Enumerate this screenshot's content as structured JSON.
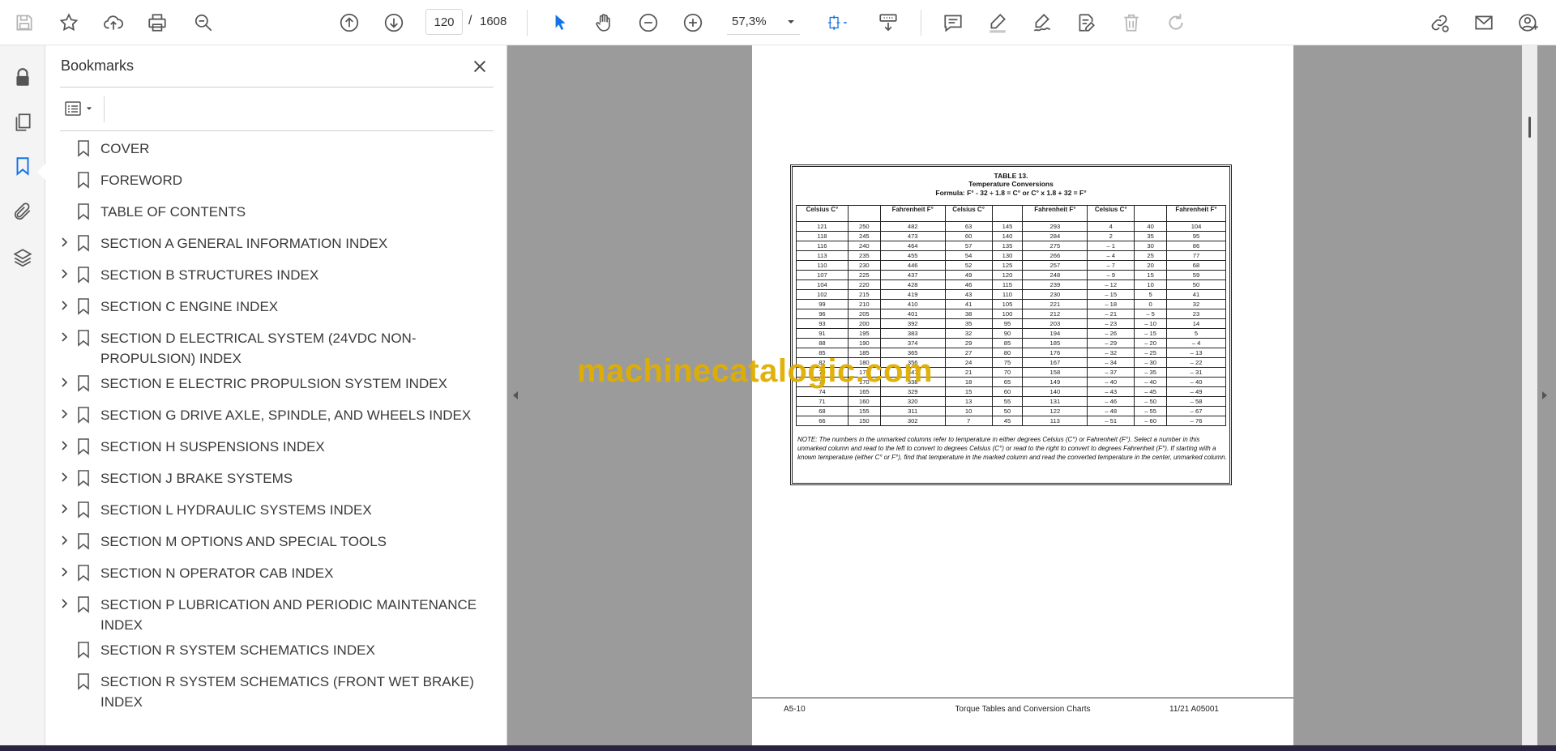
{
  "toolbar": {
    "current_page": "120",
    "page_separator": "/",
    "total_pages": "1608",
    "zoom": "57,3%"
  },
  "bookmarks_panel": {
    "title": "Bookmarks",
    "items": [
      {
        "label": "COVER",
        "expandable": false
      },
      {
        "label": "FOREWORD",
        "expandable": false
      },
      {
        "label": "TABLE OF CONTENTS",
        "expandable": false
      },
      {
        "label": "SECTION A GENERAL INFORMATION INDEX",
        "expandable": true
      },
      {
        "label": "SECTION B STRUCTURES INDEX",
        "expandable": true
      },
      {
        "label": "SECTION C ENGINE INDEX",
        "expandable": true
      },
      {
        "label": "SECTION D ELECTRICAL SYSTEM (24VDC NON-PROPULSION) INDEX",
        "expandable": true
      },
      {
        "label": "SECTION E ELECTRIC PROPULSION SYSTEM INDEX",
        "expandable": true
      },
      {
        "label": "SECTION G DRIVE AXLE, SPINDLE, AND WHEELS INDEX",
        "expandable": true
      },
      {
        "label": "SECTION H SUSPENSIONS INDEX",
        "expandable": true
      },
      {
        "label": "SECTION J BRAKE SYSTEMS",
        "expandable": true
      },
      {
        "label": "SECTION L HYDRAULIC SYSTEMS INDEX",
        "expandable": true
      },
      {
        "label": "SECTION M OPTIONS AND SPECIAL TOOLS",
        "expandable": true
      },
      {
        "label": "SECTION N OPERATOR CAB INDEX",
        "expandable": true
      },
      {
        "label": "SECTION P LUBRICATION AND PERIODIC MAINTENANCE INDEX",
        "expandable": true
      },
      {
        "label": "SECTION R SYSTEM SCHEMATICS INDEX",
        "expandable": false
      },
      {
        "label": "SECTION R SYSTEM SCHEMATICS (FRONT WET BRAKE) INDEX",
        "expandable": false
      }
    ]
  },
  "document": {
    "table_title": "TABLE 13.",
    "table_subtitle": "Temperature Conversions",
    "formula": "Formula:  F° - 32 ÷ 1.8 = C°  or  C° x 1.8 + 32 = F°",
    "headers": [
      "Celsius C°",
      "",
      "Fahrenheit F°",
      "Celsius C°",
      "",
      "Fahrenheit F°",
      "Celsius C°",
      "",
      "Fahrenheit F°"
    ],
    "rows": [
      [
        "121",
        "250",
        "482",
        "63",
        "145",
        "293",
        "4",
        "40",
        "104"
      ],
      [
        "118",
        "245",
        "473",
        "60",
        "140",
        "284",
        "2",
        "35",
        "95"
      ],
      [
        "116",
        "240",
        "464",
        "57",
        "135",
        "275",
        "– 1",
        "30",
        "86"
      ],
      [
        "113",
        "235",
        "455",
        "54",
        "130",
        "266",
        "– 4",
        "25",
        "77"
      ],
      [
        "110",
        "230",
        "446",
        "52",
        "125",
        "257",
        "– 7",
        "20",
        "68"
      ],
      [
        "107",
        "225",
        "437",
        "49",
        "120",
        "248",
        "– 9",
        "15",
        "59"
      ],
      [
        "104",
        "220",
        "428",
        "46",
        "115",
        "239",
        "– 12",
        "10",
        "50"
      ],
      [
        "102",
        "215",
        "419",
        "43",
        "110",
        "230",
        "– 15",
        "5",
        "41"
      ],
      [
        "99",
        "210",
        "410",
        "41",
        "105",
        "221",
        "– 18",
        "0",
        "32"
      ],
      [
        "96",
        "205",
        "401",
        "38",
        "100",
        "212",
        "– 21",
        "– 5",
        "23"
      ],
      [
        "93",
        "200",
        "392",
        "35",
        "95",
        "203",
        "– 23",
        "– 10",
        "14"
      ],
      [
        "91",
        "195",
        "383",
        "32",
        "90",
        "194",
        "– 26",
        "– 15",
        "5"
      ],
      [
        "88",
        "190",
        "374",
        "29",
        "85",
        "185",
        "– 29",
        "– 20",
        "– 4"
      ],
      [
        "85",
        "185",
        "365",
        "27",
        "80",
        "176",
        "– 32",
        "– 25",
        "– 13"
      ],
      [
        "82",
        "180",
        "356",
        "24",
        "75",
        "167",
        "– 34",
        "– 30",
        "– 22"
      ],
      [
        "79",
        "175",
        "347",
        "21",
        "70",
        "158",
        "– 37",
        "– 35",
        "– 31"
      ],
      [
        "77",
        "170",
        "338",
        "18",
        "65",
        "149",
        "– 40",
        "– 40",
        "– 40"
      ],
      [
        "74",
        "165",
        "329",
        "15",
        "60",
        "140",
        "– 43",
        "– 45",
        "– 49"
      ],
      [
        "71",
        "160",
        "320",
        "13",
        "55",
        "131",
        "– 46",
        "– 50",
        "– 58"
      ],
      [
        "68",
        "155",
        "311",
        "10",
        "50",
        "122",
        "– 48",
        "– 55",
        "– 67"
      ],
      [
        "66",
        "150",
        "302",
        "7",
        "45",
        "113",
        "– 51",
        "– 60",
        "– 76"
      ]
    ],
    "note": "NOTE: The numbers in the unmarked columns refer to temperature in either degrees Celsius (C°) or Fahrenheit (F°). Select a number in this unmarked column and read to the left to convert to degrees Celsius (C°) or read to the right to convert to degrees Fahrenheit (F°). If starting with a known temperature (either C° or F°), find that temperature in the marked column and read the converted temperature in the center, unmarked column.",
    "footer_left": "A5-10",
    "footer_center": "Torque Tables and Conversion Charts",
    "footer_right": "11/21  A05001"
  },
  "watermark": "machinecatalogic.com",
  "colors": {
    "accent": "#1473e6",
    "watermark": "#e0ae00",
    "document_background": "#9b9b9b"
  }
}
